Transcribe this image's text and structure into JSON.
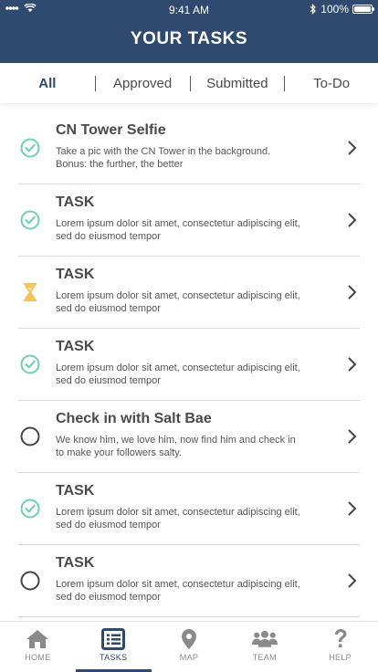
{
  "status_bar": {
    "time": "9:41 AM",
    "battery_text": "100%",
    "battery_level": 1.0,
    "signal_icon": "signal-bars-icon",
    "wifi_icon": "wifi-icon",
    "bluetooth_icon": "bluetooth-icon"
  },
  "header": {
    "title": "YOUR TASKS",
    "color": "#2f4a6e"
  },
  "filters": {
    "active": "All",
    "tabs": [
      {
        "label": "All"
      },
      {
        "label": "Approved"
      },
      {
        "label": "Submitted"
      },
      {
        "label": "To-Do"
      }
    ]
  },
  "tasks": [
    {
      "title": "CN Tower Selfie",
      "description": "Take a pic with the CN Tower in the background. Bonus: the further, the better",
      "status": "approved"
    },
    {
      "title": "TASK",
      "description": "Lorem ipsum dolor sit amet, consectetur adipiscing elit, sed do eiusmod tempor",
      "status": "approved"
    },
    {
      "title": "TASK",
      "description": "Lorem ipsum dolor sit amet, consectetur adipiscing elit, sed do eiusmod tempor",
      "status": "submitted"
    },
    {
      "title": "TASK",
      "description": "Lorem ipsum dolor sit amet, consectetur adipiscing elit, sed do eiusmod tempor",
      "status": "approved"
    },
    {
      "title": "Check in with Salt Bae",
      "description": "We know him, we love him, now find him and check in to make your followers salty.",
      "status": "todo"
    },
    {
      "title": "TASK",
      "description": "Lorem ipsum dolor sit amet, consectetur adipiscing elit, sed do eiusmod tempor",
      "status": "approved"
    },
    {
      "title": "TASK",
      "description": "Lorem ipsum dolor sit amet, consectetur adipiscing elit, sed do eiusmod tempor",
      "status": "todo"
    }
  ],
  "status_colors": {
    "approved": "#6fcfb0",
    "submitted": "#f5c15a",
    "todo": "#444444"
  },
  "bottom_nav": {
    "active": "TASKS",
    "items": [
      {
        "label": "HOME",
        "icon": "home-icon"
      },
      {
        "label": "TASKS",
        "icon": "task-list-icon"
      },
      {
        "label": "MAP",
        "icon": "map-pin-icon"
      },
      {
        "label": "TEAM",
        "icon": "team-icon"
      },
      {
        "label": "HELP",
        "icon": "help-icon"
      }
    ]
  }
}
